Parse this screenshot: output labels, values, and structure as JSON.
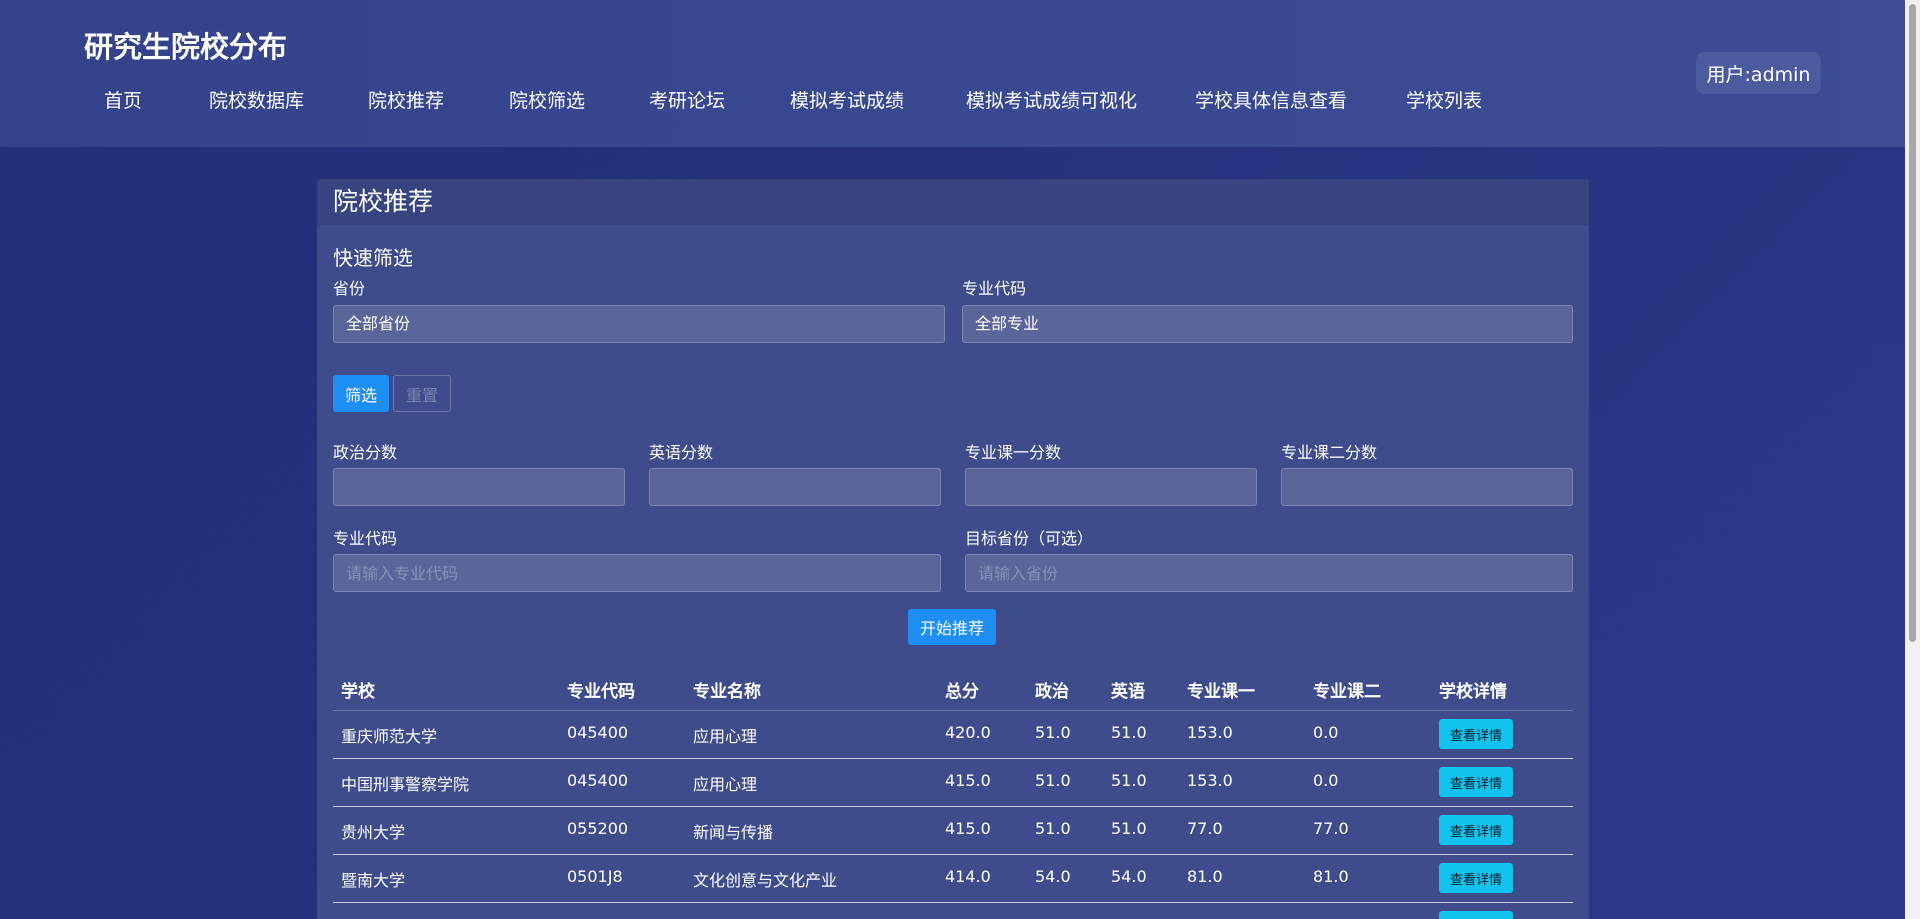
{
  "app": {
    "title": "研究生院校分布",
    "user": "用户:admin"
  },
  "nav": [
    {
      "label": "首页"
    },
    {
      "label": "院校数据库"
    },
    {
      "label": "院校推荐"
    },
    {
      "label": "院校筛选"
    },
    {
      "label": "考研论坛"
    },
    {
      "label": "模拟考试成绩"
    },
    {
      "label": "模拟考试成绩可视化"
    },
    {
      "label": "学校具体信息查看"
    },
    {
      "label": "学校列表"
    }
  ],
  "card": {
    "title": "院校推荐"
  },
  "quick_filter": {
    "title": "快速筛选",
    "province_label": "省份",
    "province_value": "全部省份",
    "major_label": "专业代码",
    "major_value": "全部专业",
    "filter_button": "筛选",
    "reset_button": "重置"
  },
  "recommend_form": {
    "politics_label": "政治分数",
    "english_label": "英语分数",
    "course1_label": "专业课一分数",
    "course2_label": "专业课二分数",
    "major_code_label": "专业代码",
    "major_code_placeholder": "请输入专业代码",
    "target_province_label": "目标省份（可选）",
    "target_province_placeholder": "请输入省份",
    "submit_button": "开始推荐"
  },
  "table": {
    "headers": [
      "学校",
      "专业代码",
      "专业名称",
      "总分",
      "政治",
      "英语",
      "专业课一",
      "专业课二",
      "学校详情"
    ],
    "detail_button": "查看详情",
    "rows": [
      {
        "school": "重庆师范大学",
        "code": "045400",
        "name": "应用心理",
        "total": "420.0",
        "politics": "51.0",
        "english": "51.0",
        "course1": "153.0",
        "course2": "0.0"
      },
      {
        "school": "中国刑事警察学院",
        "code": "045400",
        "name": "应用心理",
        "total": "415.0",
        "politics": "51.0",
        "english": "51.0",
        "course1": "153.0",
        "course2": "0.0"
      },
      {
        "school": "贵州大学",
        "code": "055200",
        "name": "新闻与传播",
        "total": "415.0",
        "politics": "51.0",
        "english": "51.0",
        "course1": "77.0",
        "course2": "77.0"
      },
      {
        "school": "暨南大学",
        "code": "0501J8",
        "name": "文化创意与文化产业",
        "total": "414.0",
        "politics": "54.0",
        "english": "54.0",
        "course1": "81.0",
        "course2": "81.0"
      }
    ]
  }
}
